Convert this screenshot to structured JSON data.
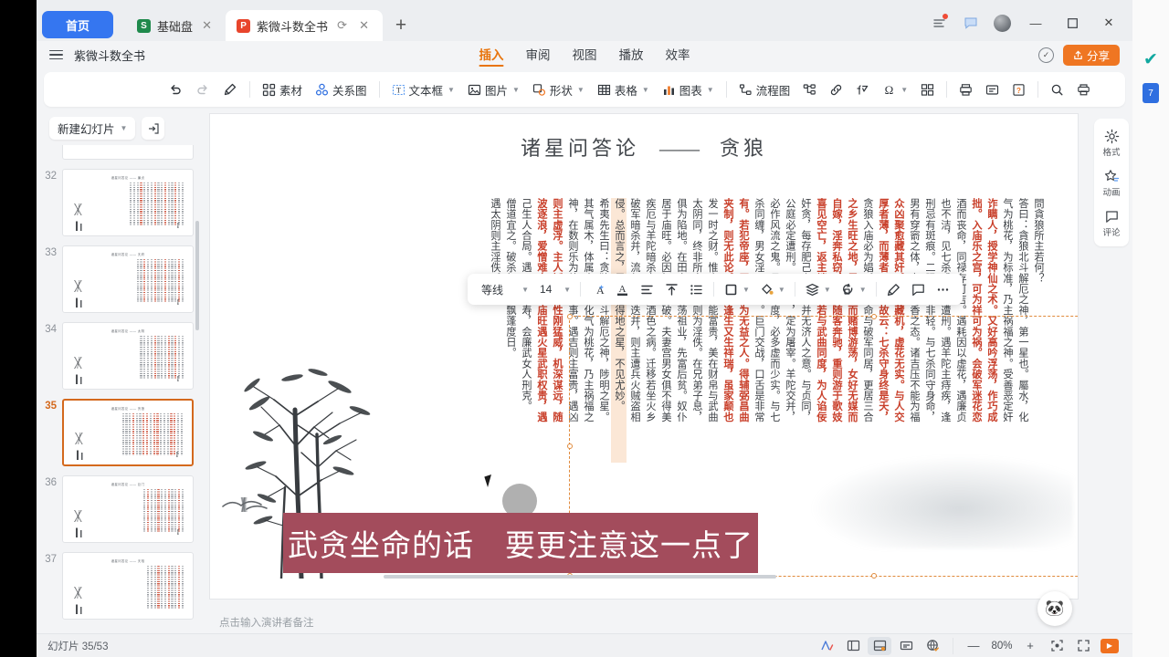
{
  "tabs": {
    "home_label": "首页",
    "items": [
      {
        "label": "基础盘",
        "icon": "sheet-icon",
        "badge": "S",
        "active": false
      },
      {
        "label": "紫微斗数全书",
        "icon": "slides-icon",
        "badge": "P",
        "active": true
      }
    ],
    "new_tab": "+"
  },
  "window": {
    "minimize": "—",
    "maximize": "▢",
    "close": "✕"
  },
  "menubar": {
    "doc_title": "紫微斗数全书",
    "menus": [
      "插入",
      "审阅",
      "视图",
      "播放",
      "效率"
    ],
    "active_menu": "插入",
    "share_label": "分享",
    "share_color": "#ef7622"
  },
  "ribbon": {
    "items": [
      {
        "name": "undo",
        "label": "",
        "icon": "undo-icon"
      },
      {
        "name": "redo",
        "label": "",
        "icon": "redo-icon"
      },
      {
        "name": "format-painter",
        "label": "",
        "icon": "format-painter-icon"
      },
      {
        "name": "material",
        "label": "素材",
        "icon": "grid-icon"
      },
      {
        "name": "relation-chart",
        "label": "关系图",
        "icon": "relation-icon"
      },
      {
        "name": "text-box",
        "label": "文本框",
        "icon": "textbox-icon"
      },
      {
        "name": "picture",
        "label": "图片",
        "icon": "image-icon"
      },
      {
        "name": "shape",
        "label": "形状",
        "icon": "shape-icon"
      },
      {
        "name": "table",
        "label": "表格",
        "icon": "table-icon"
      },
      {
        "name": "chart",
        "label": "图表",
        "icon": "chart-icon"
      },
      {
        "name": "flowchart",
        "label": "流程图",
        "icon": "flowchart-icon"
      },
      {
        "name": "smart-diagram",
        "label": "",
        "icon": "smartart-icon"
      },
      {
        "name": "hyperlink",
        "label": "",
        "icon": "link-icon"
      },
      {
        "name": "formula",
        "label": "",
        "icon": "formula-icon"
      },
      {
        "name": "symbol",
        "label": "",
        "icon": "omega-icon"
      },
      {
        "name": "screenshot",
        "label": "",
        "icon": "screenshot-icon"
      },
      {
        "name": "print-area",
        "label": "",
        "icon": "printer-icon"
      },
      {
        "name": "comment-box",
        "label": "",
        "icon": "note-icon"
      },
      {
        "name": "help-card",
        "label": "",
        "icon": "help-card-icon"
      },
      {
        "name": "search",
        "label": "",
        "icon": "search-icon"
      },
      {
        "name": "print",
        "label": "",
        "icon": "print-icon"
      }
    ]
  },
  "slide_panel": {
    "new_slide_label": "新建幻灯片",
    "import_label": "导入",
    "thumbs": [
      {
        "number": "32",
        "title": "诸星问答论 —— 廉贞",
        "selected": false
      },
      {
        "number": "33",
        "title": "诸星问答论 —— 天府",
        "selected": false
      },
      {
        "number": "34",
        "title": "诸星问答论 —— 太阴",
        "selected": false
      },
      {
        "number": "35",
        "title": "诸星问答论 —— 贪狼",
        "selected": true
      },
      {
        "number": "36",
        "title": "诸星问答论 —— 巨门",
        "selected": false
      },
      {
        "number": "37",
        "title": "诸星问答论 —— 天相",
        "selected": false
      }
    ]
  },
  "slide": {
    "title_main": "诸星问答论",
    "title_sep": "　——　",
    "title_star": "贪狼",
    "caption": "武贪坐命的话　要更注意这一点了",
    "caption_bg": "#a34c5c",
    "columns": [
      {
        "text": "問貪狼所主若何？",
        "style": "normal"
      },
      {
        "text": "答曰：貪狼北斗解厄之神，第一星也。屬水，化",
        "style": "normal"
      },
      {
        "text": "气为桃花，为标准，乃主祸福之神。受善恶定奸",
        "style": "normal"
      },
      {
        "text": "诈瞒人，授学神仙之术。又好高吟浮荡，作巧成",
        "style": "red"
      },
      {
        "text": "拙。入庙乐之宫，可为祥可为祸。会破军迷花恋",
        "style": "red"
      },
      {
        "text": "酒而丧命，同禄存可吉。遇耗因以虚花，遇廉贞",
        "style": "normal"
      },
      {
        "text": "也不洁，见七杀或配以遭刑。遇羊陀主痔疾，逢",
        "style": "normal"
      },
      {
        "text": "刑忌有斑痕。二限为祸非轻。与七杀同守身命，",
        "style": "normal"
      },
      {
        "text": "男有穿窬之体，女有偷香之态。诸吉压不能为福",
        "style": "normal"
      },
      {
        "text": "众凶聚愈藏其奸。以事藏机，虚花无实。与人交",
        "style": "red"
      },
      {
        "text": "厚者薄，而薄者又厚。故云：七杀守身终是夭，",
        "style": "red"
      },
      {
        "text": "贪狼入庙必为娼。若身命与破军同居，更居三合",
        "style": "normal"
      },
      {
        "text": "之乡生旺之地，男好饮而赌博游荡，女好无媒而",
        "style": "red"
      },
      {
        "text": "自嫁，淫奔私窃，轻则随客奔驰，重则游于歌妓",
        "style": "red"
      },
      {
        "text": "喜见空亡，返主端正。若与武曲同度，为人谄佞",
        "style": "red"
      },
      {
        "text": "奸贪，每存肥己之心，并无济人之意。与贞同，",
        "style": "normal"
      },
      {
        "text": "公庭必定遭刑。四杀同，定为屠宰。羊陀交并，",
        "style": "normal"
      },
      {
        "text": "必作风流之鬼。昌曲同度，必多虚而少实。与七",
        "style": "normal"
      },
      {
        "text": "杀同缠，男女淫邪虚花。巨门交战，口舌是非常",
        "style": "normal"
      },
      {
        "text": "有。若犯帝座，无制便为无益之人。得辅弼昌曲",
        "style": "red"
      },
      {
        "text": "夹制，则无此论。陷地逢生又生祥瑞，虽家颠也",
        "style": "red"
      },
      {
        "text": "发一时之财。惟会火铃能富贵，美在财帛与武曲",
        "style": "normal"
      },
      {
        "text": "太阴同，终非所自发，则为淫佚。在兄弟子息，",
        "style": "normal"
      },
      {
        "text": "俱为陷地。在田宅则破荡祖业，先富后贫。奴仆",
        "style": "normal"
      },
      {
        "text": "居于庙旺。必因奴仆所破。夫妻宫男女俱不得美",
        "style": "normal"
      },
      {
        "text": "疾厄与羊陀暗杀交并，酒色之病。迁移若坐火乡",
        "style": "normal"
      },
      {
        "text": "破军暗杀并，流年岁杀迭并，则主遭兵火贼盗相",
        "style": "normal"
      },
      {
        "text": "侵。总而言之，男女非得地之星，不见尤妙。",
        "style": "highlight"
      },
      {
        "text": "希夷先生曰：贪狼为北斗解厄之神，陟明之星。",
        "style": "normal"
      },
      {
        "text": "其气属木，体属水，故化气为桃花，乃主祸福之",
        "style": "normal"
      },
      {
        "text": "神，在数则乐为放荡之事。遇吉则主富贵，遇凶",
        "style": "normal"
      },
      {
        "text": "则主虚浮。主人矮小，性刚猛威，机深谋远，随",
        "style": "red"
      },
      {
        "text": "波逐浪，爱憎难定。居庙旺遇火星武职权贵，遇",
        "style": "red"
      },
      {
        "text": "己生人合局。遇天相延寿，会廉武女人刑克。",
        "style": "normal"
      },
      {
        "text": "僧道宜之。破杀相冲，飘蓬度日。",
        "style": "normal"
      },
      {
        "text": "遇太阴则主淫佚。",
        "style": "normal"
      }
    ]
  },
  "float_toolbar": {
    "font_name": "等线",
    "font_size": "14",
    "buttons": [
      {
        "name": "font-effect",
        "icon": "A-effect-icon"
      },
      {
        "name": "font-color",
        "icon": "font-color-icon"
      },
      {
        "name": "align",
        "icon": "align-icon"
      },
      {
        "name": "vertical-align",
        "icon": "vertical-align-icon"
      },
      {
        "name": "bullet-list",
        "icon": "bullet-list-icon"
      },
      {
        "name": "shape-outline",
        "icon": "shape-outline-icon"
      },
      {
        "name": "fill-color",
        "icon": "fill-bucket-icon"
      },
      {
        "name": "layer-order",
        "icon": "layers-icon"
      },
      {
        "name": "rotate",
        "icon": "rotate-icon"
      },
      {
        "name": "format-painter",
        "icon": "format-painter-icon"
      },
      {
        "name": "comment",
        "icon": "comment-icon"
      },
      {
        "name": "more",
        "icon": "ellipsis-icon"
      }
    ]
  },
  "notes": {
    "placeholder": "点击输入演讲者备注"
  },
  "right_rail": [
    {
      "label": "格式",
      "icon": "gear-icon"
    },
    {
      "label": "动画",
      "icon": "star-animation-icon"
    },
    {
      "label": "评论",
      "icon": "comment-icon"
    }
  ],
  "status_bar": {
    "slide_counter": "幻灯片 35/53",
    "zoom": "80%",
    "zoom_out": "—",
    "zoom_in": "+",
    "buttons": [
      {
        "name": "ai-assistant",
        "icon": "ai-icon"
      },
      {
        "name": "normal-view",
        "icon": "normal-view-icon"
      },
      {
        "name": "notes-view",
        "icon": "notes-view-icon"
      },
      {
        "name": "reading-view",
        "icon": "reading-view-icon"
      },
      {
        "name": "web-view",
        "icon": "globe-check-icon"
      },
      {
        "name": "fit-slide",
        "icon": "fit-icon"
      },
      {
        "name": "fullscreen",
        "icon": "fullscreen-icon"
      },
      {
        "name": "play",
        "icon": "play-icon"
      }
    ]
  }
}
